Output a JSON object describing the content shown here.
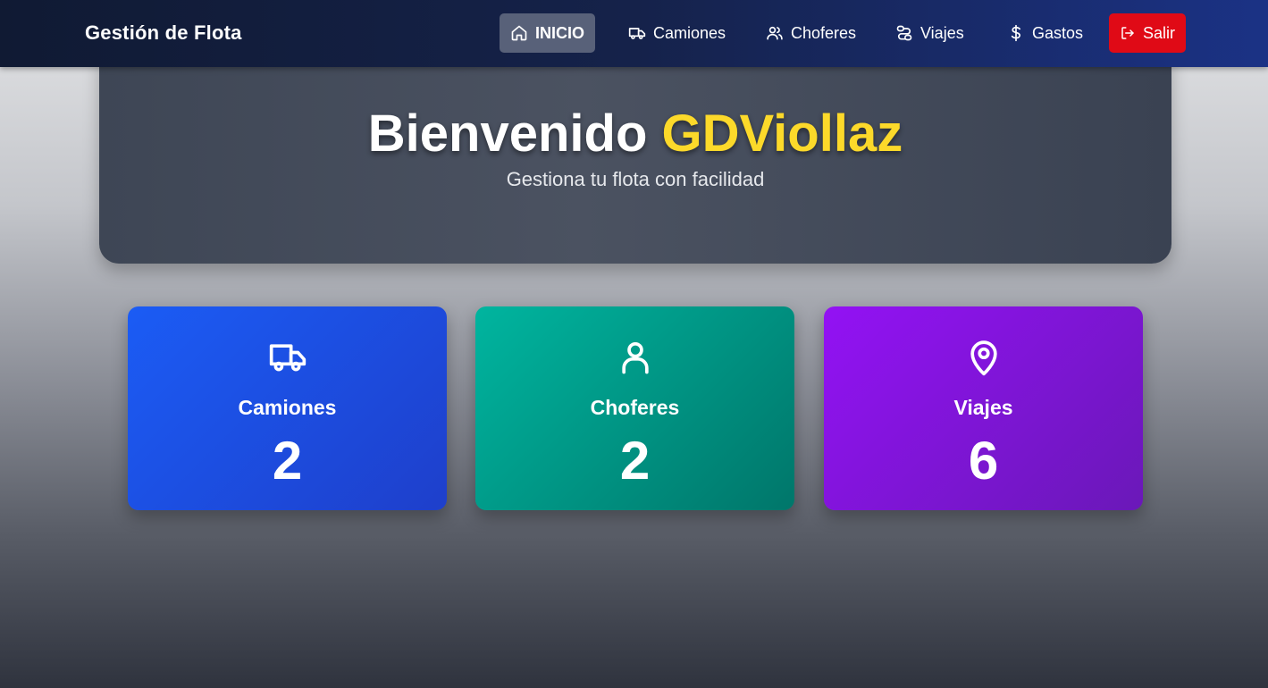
{
  "nav": {
    "brand": "Gestión de Flota",
    "items": [
      {
        "label": "INICIO",
        "icon": "home-icon",
        "active": true
      },
      {
        "label": "Camiones",
        "icon": "truck-icon"
      },
      {
        "label": "Choferes",
        "icon": "users-icon"
      },
      {
        "label": "Viajes",
        "icon": "route-icon"
      },
      {
        "label": "Gastos",
        "icon": "dollar-icon"
      }
    ],
    "logout": {
      "label": "Salir",
      "icon": "logout-icon"
    }
  },
  "hero": {
    "greeting": "Bienvenido",
    "username": "GDViollaz",
    "subtitle": "Gestiona tu flota con facilidad"
  },
  "stats": [
    {
      "label": "Camiones",
      "value": "2",
      "icon": "truck-icon",
      "color": "#1b5cf5"
    },
    {
      "label": "Choferes",
      "value": "2",
      "icon": "user-icon",
      "color": "#00a48f"
    },
    {
      "label": "Viajes",
      "value": "6",
      "icon": "map-pin-icon",
      "color": "#8a14e8"
    }
  ],
  "colors": {
    "nav_active_bg": "#586179",
    "logout_bg": "#e00a16",
    "username": "#fcd92a"
  }
}
